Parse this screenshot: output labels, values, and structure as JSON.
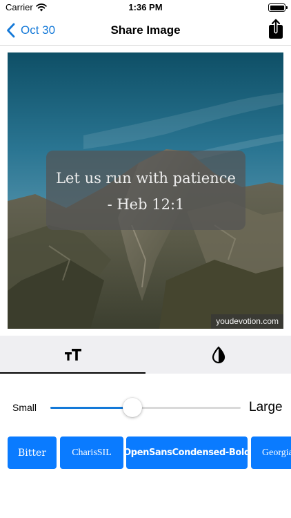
{
  "status_bar": {
    "carrier": "Carrier",
    "time": "1:36 PM"
  },
  "nav": {
    "back_label": "Oct 30",
    "title": "Share Image"
  },
  "image": {
    "quote_line_1": "Let us run with patience",
    "quote_line_2": "- Heb 12:1",
    "watermark": "youdevotion.com"
  },
  "tabs": [
    {
      "icon": "text-size-icon",
      "selected": true
    },
    {
      "icon": "contrast-icon",
      "selected": false
    }
  ],
  "slider": {
    "min_label": "Small",
    "max_label": "Large",
    "value": 0.43
  },
  "fonts": [
    {
      "label": "Bitter"
    },
    {
      "label": "CharisSIL"
    },
    {
      "label": "OpenSansCondensed-Bold"
    },
    {
      "label": "Georgia"
    }
  ],
  "colors": {
    "accent": "#0a7bff",
    "link": "#1479d8"
  }
}
